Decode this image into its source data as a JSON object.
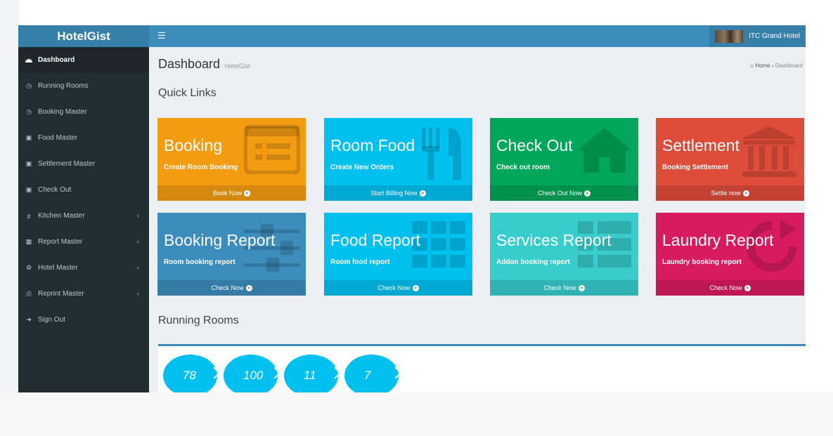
{
  "app": {
    "logo": "HotelGist",
    "hotel_name": "ITC Grand Hotel",
    "menu_icon": "hamburger-icon"
  },
  "sidebar": {
    "items": [
      {
        "label": "Dashboard",
        "icon": "dashboard-icon"
      },
      {
        "label": "Running Rooms",
        "icon": "clock-icon"
      },
      {
        "label": "Booking Master",
        "icon": "clock-icon"
      },
      {
        "label": "Food Master",
        "icon": "id-card-icon"
      },
      {
        "label": "Settlement Master",
        "icon": "id-card-icon"
      },
      {
        "label": "Check Out",
        "icon": "id-card-icon"
      },
      {
        "label": "Kitchen Master",
        "icon": "cutlery-icon"
      },
      {
        "label": "Report Master",
        "icon": "table-icon"
      },
      {
        "label": "Hotel Master",
        "icon": "cogs-icon"
      },
      {
        "label": "Reprint Master",
        "icon": "print-icon"
      },
      {
        "label": "Sign Out",
        "icon": "sign-out-icon"
      }
    ]
  },
  "page": {
    "title": "Dashboard",
    "subtitle": "HotelGist",
    "breadcrumb": {
      "home": "Home",
      "current": "Dashboard"
    },
    "quick_links_title": "Quick Links",
    "running_rooms_title": "Running Rooms"
  },
  "tiles": [
    {
      "title": "Booking",
      "subtitle": "Create Room Booking",
      "footer": "Book Now",
      "color": "#f39c12",
      "icon": "list-icon"
    },
    {
      "title": "Room Food",
      "subtitle": "Create New Orders",
      "footer": "Start Billing Now",
      "color": "#00c0ef",
      "icon": "cutlery-icon"
    },
    {
      "title": "Check Out",
      "subtitle": "Check out room",
      "footer": "Check Out Now",
      "color": "#00a65a",
      "icon": "home-icon"
    },
    {
      "title": "Settlement",
      "subtitle": "Booking Settlement",
      "footer": "Settle now",
      "color": "#dd4b39",
      "icon": "bank-icon"
    },
    {
      "title": "Booking Report",
      "subtitle": "Room booking report",
      "footer": "Check Now",
      "color": "#3c8dbc",
      "icon": "sliders-icon"
    },
    {
      "title": "Food Report",
      "subtitle": "Room food report",
      "footer": "Check Now",
      "color": "#00c0ef",
      "icon": "th-icon"
    },
    {
      "title": "Services Report",
      "subtitle": "Addon booking report",
      "footer": "Check Now",
      "color": "#39cccc",
      "icon": "th-large-icon"
    },
    {
      "title": "Laundry Report",
      "subtitle": "Laundry booking report",
      "footer": "Check Now",
      "color": "#d81b60",
      "icon": "refresh-icon"
    }
  ],
  "running_rooms": [
    "78",
    "100",
    "11",
    "7"
  ]
}
